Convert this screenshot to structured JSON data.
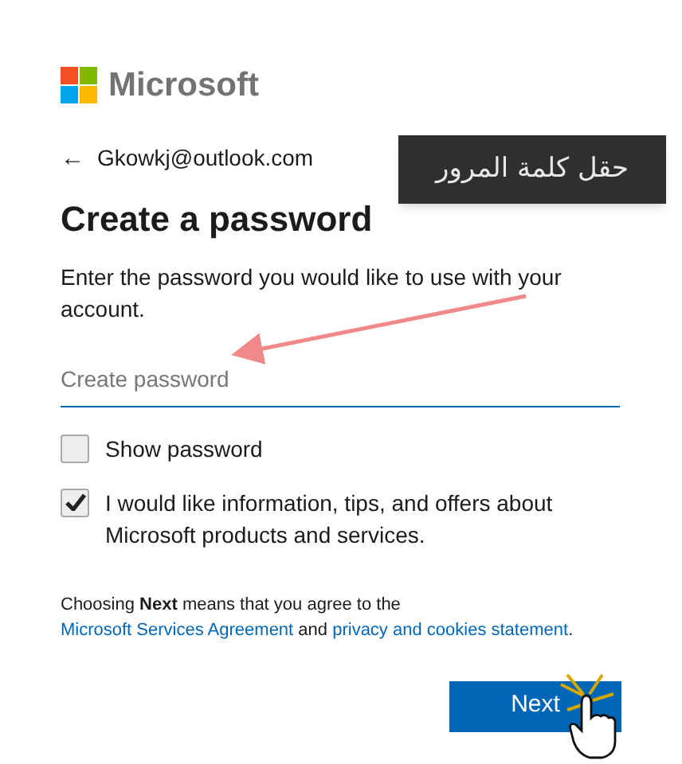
{
  "brand": {
    "name": "Microsoft"
  },
  "back": {
    "icon": "←",
    "email": "Gkowkj@outlook.com"
  },
  "heading": "Create a password",
  "description": "Enter the password you would like to use with your account.",
  "password_field": {
    "placeholder": "Create password"
  },
  "checkboxes": [
    {
      "label": "Show password",
      "checked": false
    },
    {
      "label": "I would like information, tips, and offers about Microsoft products and services.",
      "checked": true
    }
  ],
  "legal": [
    {
      "kind": "text",
      "text": "Choosing **Next** means that you agree to the "
    },
    {
      "kind": "link",
      "text": "Microsoft Services Agreement"
    },
    {
      "kind": "text",
      "text": " and "
    },
    {
      "kind": "link",
      "text": "privacy and cookies statement"
    },
    {
      "kind": "text",
      "text": "."
    }
  ],
  "next_button": "Next",
  "annotation": {
    "label": "حقل كلمة المرور"
  }
}
